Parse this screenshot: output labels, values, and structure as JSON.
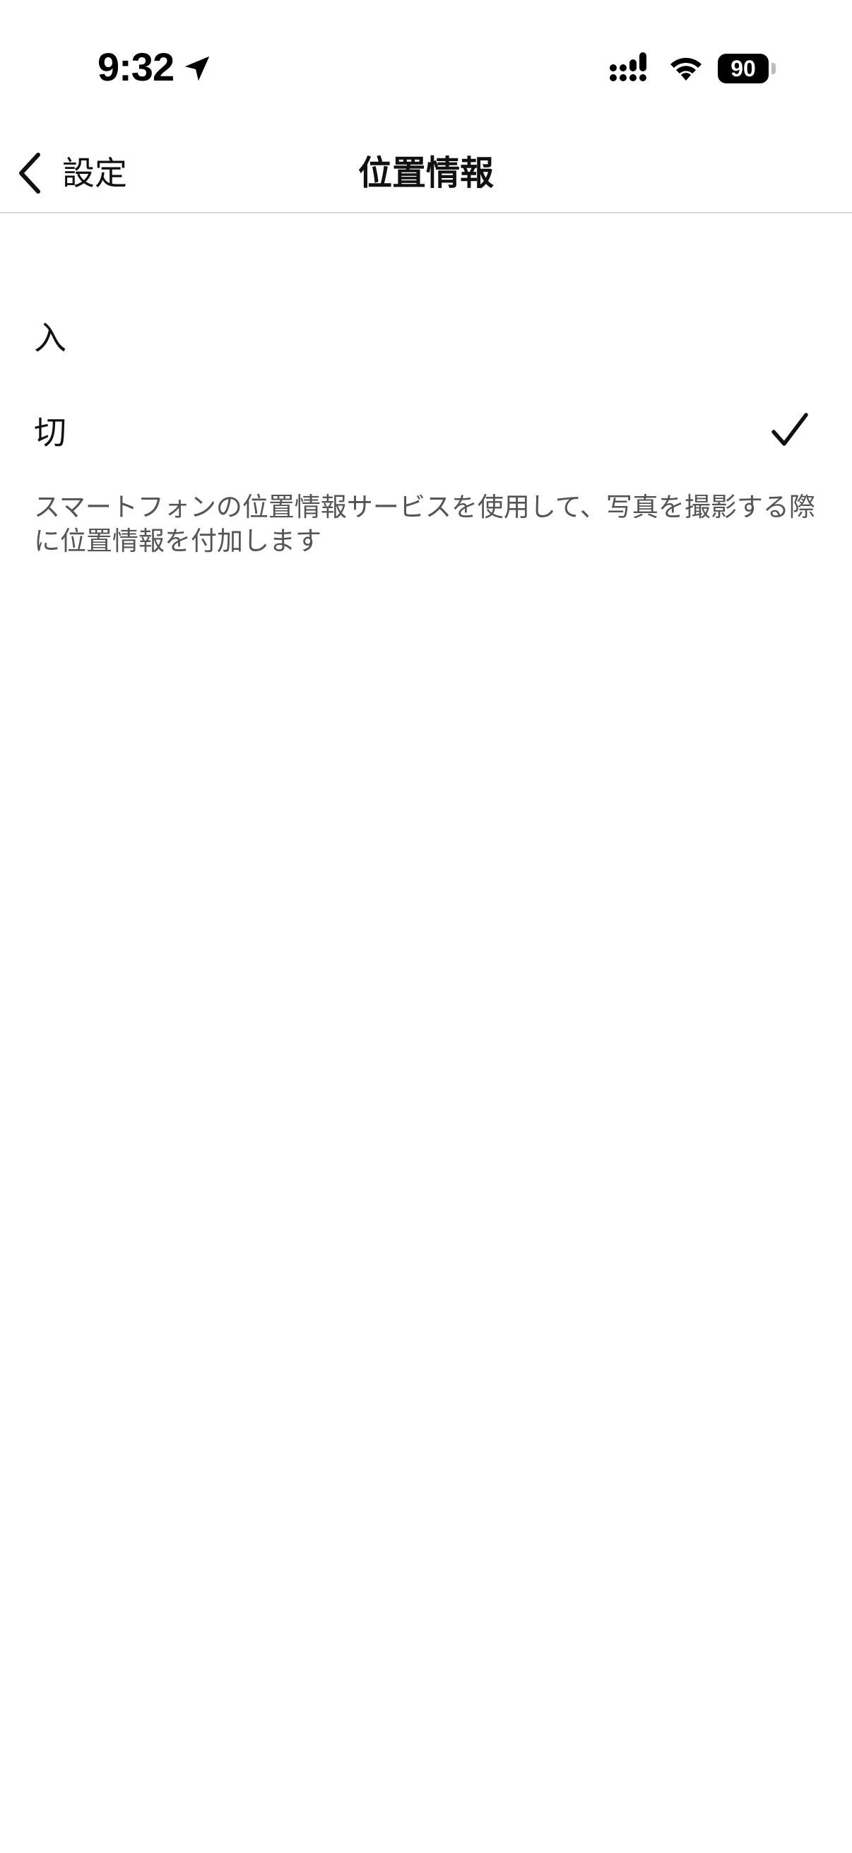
{
  "status_bar": {
    "time": "9:32",
    "battery_level": "90",
    "icons": [
      "location-arrow-icon",
      "signal-icon",
      "wifi-icon",
      "battery-icon"
    ]
  },
  "nav": {
    "back_label": "設定",
    "title": "位置情報"
  },
  "options": [
    {
      "label": "入",
      "selected": false
    },
    {
      "label": "切",
      "selected": true
    }
  ],
  "description": "スマートフォンの位置情報サービスを使用して、写真を撮影する際に位置情報を付加します",
  "colors": {
    "text": "#111111",
    "secondary_text": "#555555",
    "divider": "#d9d9d9",
    "background": "#ffffff"
  }
}
